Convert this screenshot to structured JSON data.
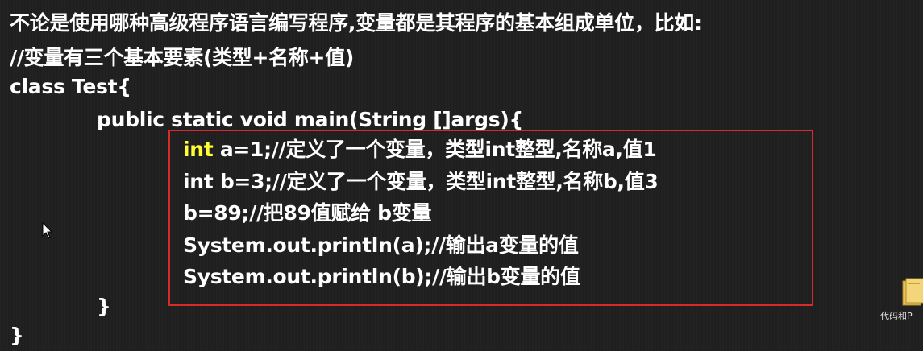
{
  "text": {
    "intro": "不论是使用哪种高级程序语言编写程序,变量都是其程序的基本组成单位，比如:",
    "comment": "//变量有三个基本要素(类型+名称+值)",
    "class_decl": "class Test{",
    "main_decl": "public static void main(String []args){",
    "code_line1_kw": "int",
    "code_line1_rest": " a=1;//定义了一个变量，类型int整型,名称a,值1",
    "code_line2": "int b=3;//定义了一个变量，类型int整型,名称b,值3",
    "code_line3": "b=89;//把89值赋给 b变量",
    "code_line4": "System.out.println(a);//输出a变量的值",
    "code_line5": "System.out.println(b);//输出b变量的值",
    "main_close": "}",
    "class_close": "}"
  },
  "desktop": {
    "folder_label": "代码和P"
  },
  "colors": {
    "background": "#1f1f1f",
    "text": "#ffffff",
    "keyword_highlight": "#ffff33",
    "box_border": "#d62b2b"
  },
  "icons": {
    "cursor": "mouse-pointer-icon",
    "folder": "folder-icon"
  }
}
